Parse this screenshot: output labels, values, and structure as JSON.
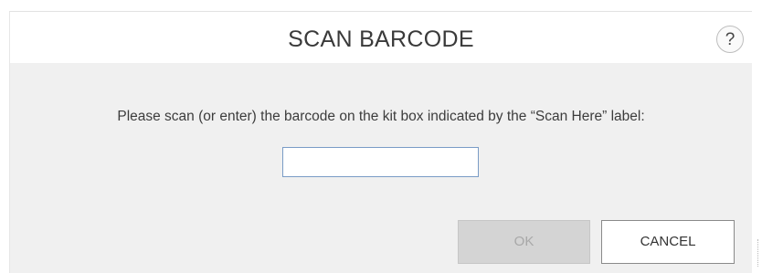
{
  "dialog": {
    "title": "SCAN BARCODE",
    "help_label": "?",
    "prompt": "Please scan (or enter) the barcode on the kit box indicated by the “Scan Here” label:",
    "barcode_input": {
      "value": "",
      "placeholder": ""
    },
    "ok_label": "OK",
    "ok_enabled": false,
    "cancel_label": "CANCEL"
  },
  "icons": {
    "help": "help-icon"
  },
  "colors": {
    "dialog_background": "#f0f0f0",
    "header_background": "#ffffff",
    "input_border": "#7a9cc6",
    "ok_disabled_background": "#d4d4d4",
    "ok_disabled_text": "#a8a8a8",
    "cancel_border": "#8a8a8a"
  }
}
